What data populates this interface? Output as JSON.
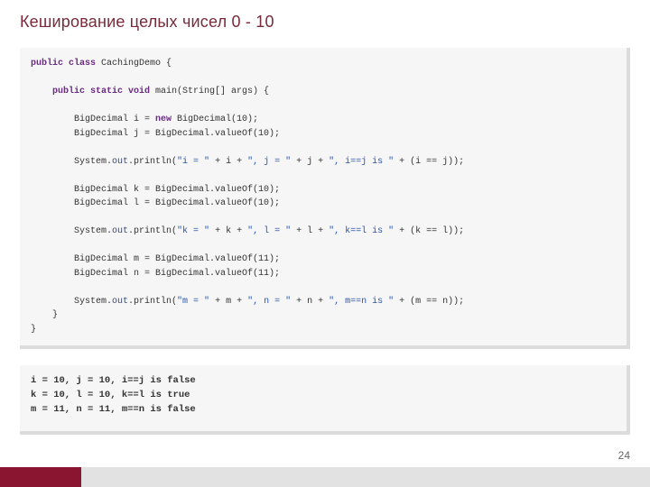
{
  "title": "Кеширование целых чисел 0 - 10",
  "pageNumber": "24",
  "code": {
    "l01a": "public class",
    "l01b": " CachingDemo {",
    "l02a": "    public static void",
    "l02b": " main(String[] args) {",
    "l03a": "        BigDecimal i = ",
    "l03b": "new",
    "l03c": " BigDecimal(10);",
    "l04": "        BigDecimal j = BigDecimal.valueOf(10);",
    "l05a": "        System.",
    "l05b": "out",
    "l05c": ".println(",
    "l05d": "\"i = \"",
    "l05e": " + i + ",
    "l05f": "\", j = \"",
    "l05g": " + j + ",
    "l05h": "\", i==j is \"",
    "l05i": " + (i == j));",
    "l06": "        BigDecimal k = BigDecimal.valueOf(10);",
    "l07": "        BigDecimal l = BigDecimal.valueOf(10);",
    "l08a": "        System.",
    "l08b": "out",
    "l08c": ".println(",
    "l08d": "\"k = \"",
    "l08e": " + k + ",
    "l08f": "\", l = \"",
    "l08g": " + l + ",
    "l08h": "\", k==l is \"",
    "l08i": " + (k == l));",
    "l09": "        BigDecimal m = BigDecimal.valueOf(11);",
    "l10": "        BigDecimal n = BigDecimal.valueOf(11);",
    "l11a": "        System.",
    "l11b": "out",
    "l11c": ".println(",
    "l11d": "\"m = \"",
    "l11e": " + m + ",
    "l11f": "\", n = \"",
    "l11g": " + n + ",
    "l11h": "\", m==n is \"",
    "l11i": " + (m == n));",
    "l12": "    }",
    "l13": "}"
  },
  "output": {
    "o1": "i = 10, j = 10, i==j is false",
    "o2": "k = 10, l = 10, k==l is true",
    "o3": "m = 11, n = 11, m==n is false"
  }
}
